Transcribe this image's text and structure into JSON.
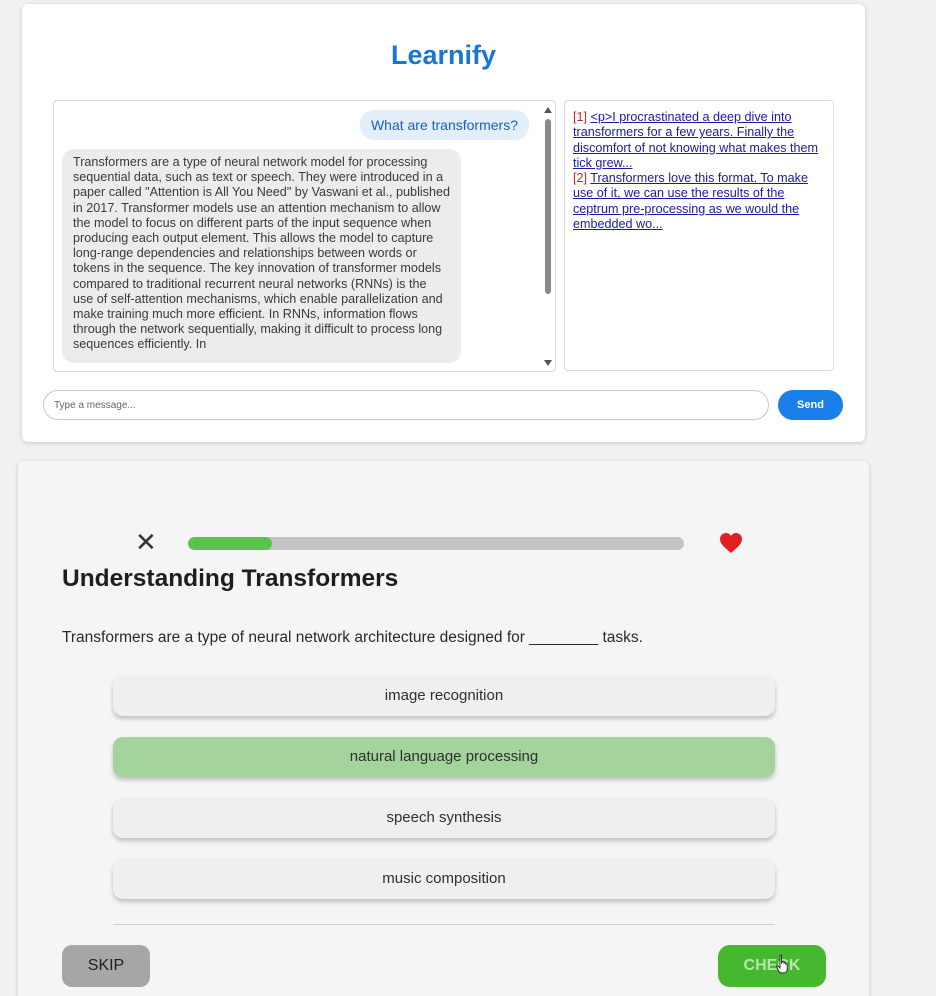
{
  "app": {
    "title": "Learnify"
  },
  "chat": {
    "user_message": "What are transformers?",
    "bot_message": "Transformers are a type of neural network model for processing sequential data, such as text or speech. They were introduced in a paper called \"Attention is All You Need\" by Vaswani et al., published in 2017. Transformer models use an attention mechanism to allow the model to focus on different parts of the input sequence when producing each output element. This allows the model to capture long-range dependencies and relationships between words or tokens in the sequence. The key innovation of transformer models compared to traditional recurrent neural networks (RNNs) is the use of self-attention mechanisms, which enable parallelization and make training much more efficient. In RNNs, information flows through the network sequentially, making it difficult to process long sequences efficiently. In"
  },
  "references": [
    {
      "num": "[1]",
      "text": "<p>I procrastinated a deep dive into transformers for a few years. Finally the discomfort of not knowing what makes them tick grew..."
    },
    {
      "num": "[2]",
      "text": "Transformers love this format. To make use of it, we can use the results of the ceptrum pre-processing as we would the embedded wo..."
    }
  ],
  "input": {
    "placeholder": "Type a message...",
    "value": ""
  },
  "send_button": {
    "label": "Send",
    "color": "#1a7fe8"
  },
  "quiz": {
    "progress": 0.17,
    "close_icon": "close-icon",
    "heart_icon": "heart-icon",
    "title": "Understanding Transformers",
    "question": "Transformers are a type of neural network architecture designed for ________ tasks.",
    "options": [
      {
        "label": "image recognition",
        "selected": false
      },
      {
        "label": "natural language processing",
        "selected": true
      },
      {
        "label": "speech synthesis",
        "selected": false
      },
      {
        "label": "music composition",
        "selected": false
      }
    ],
    "skip_label": "SKIP",
    "check_label": "CHECK",
    "colors": {
      "accent_green": "#45b82f",
      "selected_option": "#a4d39b",
      "heart": "#e02020"
    }
  }
}
